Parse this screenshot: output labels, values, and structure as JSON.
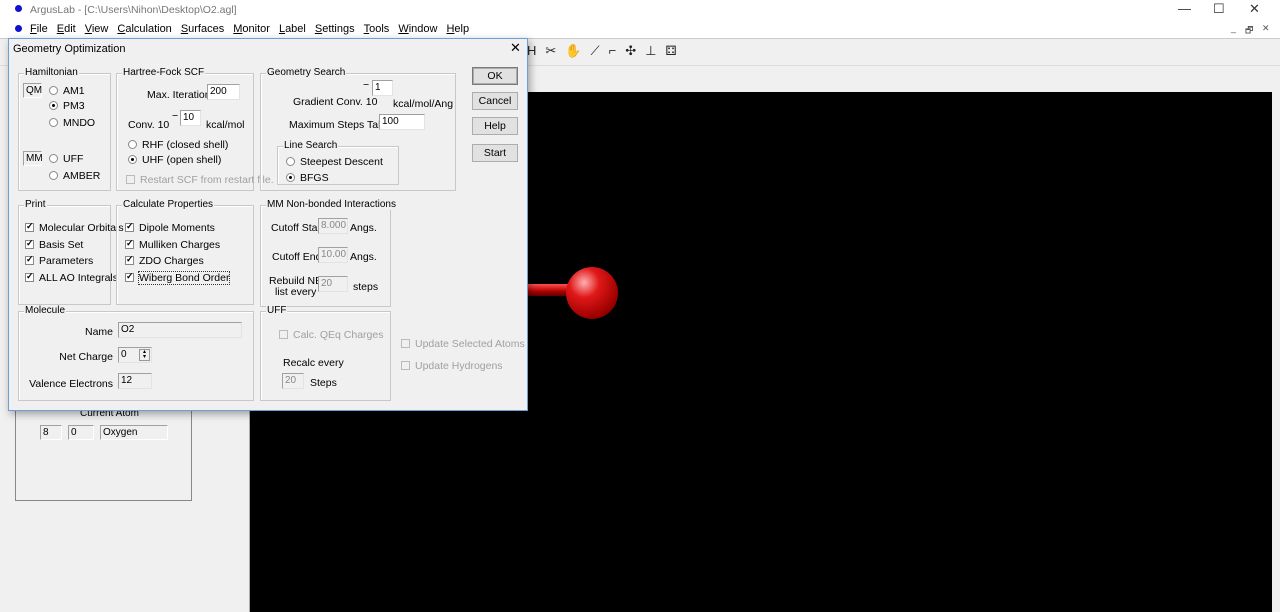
{
  "window": {
    "title": "ArgusLab - [C:\\Users\\Nihon\\Desktop\\O2.agl]",
    "minimize": "—",
    "maximize": "☐",
    "close": "✕",
    "mdi_min": "_",
    "mdi_restore": "🗗",
    "mdi_close": "✕"
  },
  "menu": [
    "File",
    "Edit",
    "View",
    "Calculation",
    "Surfaces",
    "Monitor",
    "Label",
    "Settings",
    "Tools",
    "Window",
    "Help"
  ],
  "toolbar_icons": [
    "H",
    "✂",
    "✋",
    "⟋",
    "⌐",
    "✣",
    "⊥",
    "⚃"
  ],
  "left_panel": {
    "current_atom_label": "Current Atom",
    "atomic_number": "8",
    "charge": "0",
    "element": "Oxygen"
  },
  "dialog": {
    "title": "Geometry Optimization",
    "close": "✕",
    "buttons": {
      "ok": "OK",
      "cancel": "Cancel",
      "help": "Help",
      "start": "Start"
    },
    "hamiltonian": {
      "legend": "Hamiltonian",
      "qm": "QM",
      "mm": "MM",
      "am1": "AM1",
      "pm3": "PM3",
      "mndo": "MNDO",
      "uff": "UFF",
      "amber": "AMBER",
      "selected": "PM3"
    },
    "hf": {
      "legend": "Hartree-Fock SCF",
      "max_iter_label": "Max. Iterations",
      "max_iter": "200",
      "conv_label": "Conv. 10",
      "minus": "−",
      "conv_exp": "10",
      "conv_unit": "kcal/mol",
      "rhf": "RHF (closed shell)",
      "uhf": "UHF (open shell)",
      "restart": "Restart SCF from restart file."
    },
    "geom": {
      "legend": "Geometry Search",
      "minus": "−",
      "grad_exp": "1",
      "grad_label": "Gradient Conv. 10",
      "grad_unit": "kcal/mol/Ang",
      "max_steps_label": "Maximum Steps Taken",
      "max_steps": "100",
      "line_search": "Line Search",
      "steepest": "Steepest Descent",
      "bfgs": "BFGS"
    },
    "print": {
      "legend": "Print",
      "items": [
        "Molecular Orbitals",
        "Basis Set",
        "Parameters",
        "ALL AO Integrals"
      ]
    },
    "calc": {
      "legend": "Calculate Properties",
      "items": [
        "Dipole Moments",
        "Mulliken Charges",
        "ZDO Charges",
        "Wiberg Bond Order"
      ]
    },
    "mm": {
      "legend": "MM Non-bonded Interactions",
      "cutoff_start_label": "Cutoff Start",
      "cutoff_start": "8.000",
      "cutoff_end_label": "Cutoff End",
      "cutoff_end": "10.00",
      "angs": "Angs.",
      "rebuild1": "Rebuild NB",
      "rebuild2": "list every",
      "rebuild": "20",
      "steps": "steps"
    },
    "molecule": {
      "legend": "Molecule",
      "name_label": "Name",
      "name": "O2",
      "charge_label": "Net Charge",
      "charge": "0",
      "valence_label": "Valence Electrons",
      "valence": "12"
    },
    "uff": {
      "legend": "UFF",
      "qeq": "Calc. QEq Charges",
      "recalc": "Recalc every",
      "recalc_val": "20",
      "steps": "Steps"
    },
    "update_selected": "Update Selected Atoms",
    "update_h": "Update Hydrogens"
  },
  "colors": {
    "atom": "#d01010",
    "viewport": "#000000"
  }
}
